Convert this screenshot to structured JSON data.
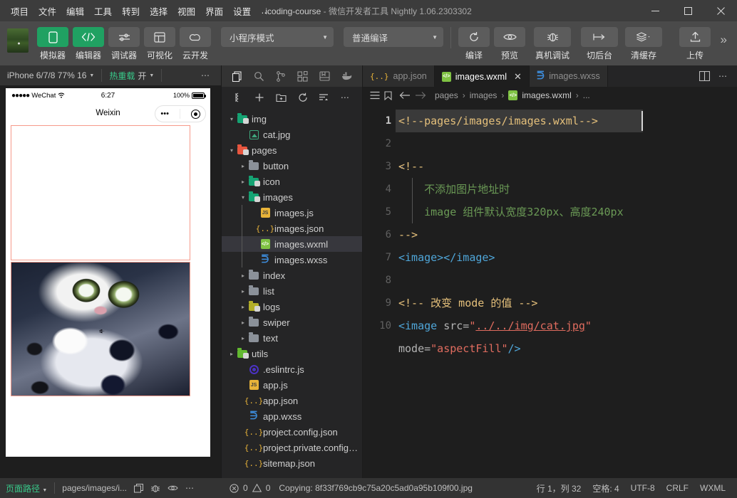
{
  "titlebar": {
    "menus": [
      "项目",
      "文件",
      "编辑",
      "工具",
      "转到",
      "选择",
      "视图",
      "界面",
      "设置",
      "…"
    ],
    "project_name": "icoding-course",
    "dash": "-",
    "app_name": "微信开发者工具 Nightly 1.06.2303302",
    "minimize": "—",
    "maximize": "□",
    "close": "✕"
  },
  "toolbar": {
    "buttons": [
      {
        "label": "模拟器",
        "icon": "phone-icon",
        "active": true
      },
      {
        "label": "编辑器",
        "icon": "code-icon",
        "active": true
      },
      {
        "label": "调试器",
        "icon": "sliders-icon",
        "active": false
      },
      {
        "label": "可视化",
        "icon": "layout-icon",
        "active": false
      },
      {
        "label": "云开发",
        "icon": "cloud-icon",
        "active": false
      }
    ],
    "mode_select": "小程序模式",
    "compile_select": "普通编译",
    "actions": [
      {
        "label": "编译",
        "icon": "refresh-icon"
      },
      {
        "label": "预览",
        "icon": "eye-icon"
      },
      {
        "label": "真机调试",
        "icon": "bug-icon"
      },
      {
        "label": "切后台",
        "icon": "background-icon"
      },
      {
        "label": "清缓存",
        "icon": "layers-icon"
      },
      {
        "label": "上传",
        "icon": "upload-icon"
      }
    ],
    "overflow": "»"
  },
  "simulator": {
    "device": "iPhone 6/7/8 77% 16",
    "hotreload_label": "热重载",
    "hotreload_value": "开",
    "more": "⋯",
    "phone": {
      "signal_dots": "●●●●●",
      "carrier": "WeChat",
      "wifi": "wifi-icon",
      "time": "6:27",
      "battery_pct": "100%",
      "nav_title": "Weixin",
      "capsule_menu": "•••",
      "capsule_target": "target-icon"
    }
  },
  "explorer": {
    "activity_icons": [
      "files-icon",
      "search-icon",
      "source-control-icon",
      "extensions-icon",
      "debug-icon",
      "docker-icon"
    ],
    "tool_icons": [
      "collapse-icon",
      "new-file-icon",
      "new-folder-icon",
      "refresh-icon",
      "sort-icon",
      "more-icon"
    ],
    "tree": [
      {
        "name": "img",
        "depth": 0,
        "type": "folder",
        "icon": "folder-teal",
        "arrow": "▾"
      },
      {
        "name": "cat.jpg",
        "depth": 1,
        "type": "image",
        "icon": "image-file",
        "arrow": ""
      },
      {
        "name": "pages",
        "depth": 0,
        "type": "folder",
        "icon": "folder-red",
        "arrow": "▾"
      },
      {
        "name": "button",
        "depth": 1,
        "type": "folder",
        "icon": "folder-gray",
        "arrow": "▸"
      },
      {
        "name": "icon",
        "depth": 1,
        "type": "folder",
        "icon": "folder-teal",
        "arrow": "▸"
      },
      {
        "name": "images",
        "depth": 1,
        "type": "folder",
        "icon": "folder-teal",
        "arrow": "▾"
      },
      {
        "name": "images.js",
        "depth": 2,
        "type": "js",
        "icon": "js-file",
        "arrow": ""
      },
      {
        "name": "images.json",
        "depth": 2,
        "type": "json",
        "icon": "json-file",
        "arrow": ""
      },
      {
        "name": "images.wxml",
        "depth": 2,
        "type": "wxml",
        "icon": "wxml-file",
        "arrow": "",
        "selected": true
      },
      {
        "name": "images.wxss",
        "depth": 2,
        "type": "wxss",
        "icon": "wxss-file",
        "arrow": ""
      },
      {
        "name": "index",
        "depth": 1,
        "type": "folder",
        "icon": "folder-gray",
        "arrow": "▸"
      },
      {
        "name": "list",
        "depth": 1,
        "type": "folder",
        "icon": "folder-gray",
        "arrow": "▸"
      },
      {
        "name": "logs",
        "depth": 1,
        "type": "folder",
        "icon": "folder-olive",
        "arrow": "▸"
      },
      {
        "name": "swiper",
        "depth": 1,
        "type": "folder",
        "icon": "folder-gray",
        "arrow": "▸"
      },
      {
        "name": "text",
        "depth": 1,
        "type": "folder",
        "icon": "folder-gray",
        "arrow": "▸"
      },
      {
        "name": "utils",
        "depth": 0,
        "type": "folder",
        "icon": "folder-green",
        "arrow": "▸"
      },
      {
        "name": ".eslintrc.js",
        "depth": 1,
        "type": "eslint",
        "icon": "eslint-file",
        "arrow": ""
      },
      {
        "name": "app.js",
        "depth": 1,
        "type": "js",
        "icon": "js-file",
        "arrow": ""
      },
      {
        "name": "app.json",
        "depth": 1,
        "type": "json",
        "icon": "json-file",
        "arrow": ""
      },
      {
        "name": "app.wxss",
        "depth": 1,
        "type": "wxss",
        "icon": "wxss-file",
        "arrow": ""
      },
      {
        "name": "project.config.json",
        "depth": 1,
        "type": "json",
        "icon": "json-file",
        "arrow": ""
      },
      {
        "name": "project.private.config.js...",
        "depth": 1,
        "type": "json",
        "icon": "json-file",
        "arrow": ""
      },
      {
        "name": "sitemap.json",
        "depth": 1,
        "type": "json",
        "icon": "json-file",
        "arrow": ""
      }
    ]
  },
  "editor": {
    "tabs": [
      {
        "label": "app.json",
        "icon": "json-file",
        "active": false,
        "closable": false
      },
      {
        "label": "images.wxml",
        "icon": "wxml-file",
        "active": true,
        "closable": true,
        "close": "✕"
      },
      {
        "label": "images.wxss",
        "icon": "wxss-file",
        "active": false,
        "closable": false
      }
    ],
    "tab_actions": [
      "split-editor-icon",
      "more-icon"
    ],
    "breadcrumb": {
      "icons": [
        "outline-icon",
        "bookmark-icon",
        "back-arrow-icon",
        "forward-arrow-icon"
      ],
      "parts": [
        "pages",
        "images",
        "images.wxml",
        "..."
      ],
      "separator": "›"
    },
    "lines": [
      {
        "no": "1",
        "current": true
      },
      {
        "no": "2",
        "current": false
      },
      {
        "no": "3",
        "current": false,
        "fold": "⌄"
      },
      {
        "no": "4",
        "current": false
      },
      {
        "no": "5",
        "current": false
      },
      {
        "no": "6",
        "current": false
      },
      {
        "no": "7",
        "current": false
      },
      {
        "no": "8",
        "current": false
      },
      {
        "no": "9",
        "current": false
      },
      {
        "no": "10",
        "current": false
      },
      {
        "no": "",
        "current": false
      }
    ],
    "code": {
      "l1": "<!--pages/images/images.wxml-->",
      "l3": "<!--",
      "l4": "不添加图片地址时",
      "l5": "image 组件默认宽度320px、高度240px",
      "l6": "-->",
      "l7_open": "<image>",
      "l7_close": "</image>",
      "l9": "<!-- 改变 mode 的值 -->",
      "l10_tag": "<image",
      "l10_attr": " src=",
      "l10_q": "\"",
      "l10_val": "../../img/cat.jpg",
      "l11_attr": "mode=",
      "l11_val": "\"aspectFill\"",
      "l11_end": "/>"
    }
  },
  "statusbar": {
    "page_path_label": "页面路径",
    "page_path_value": "pages/images/i...",
    "left_icons": [
      "copy-icon",
      "bug-icon",
      "eye-icon",
      "more-icon"
    ],
    "errors": "0",
    "warnings": "0",
    "message": "Copying: 8f33f769cb9c75a20c5ad0a95b109f00.jpg",
    "cursor": "行 1，列 32",
    "spaces": "空格: 4",
    "encoding": "UTF-8",
    "eol": "CRLF",
    "language": "WXML"
  },
  "colors": {
    "accent_green": "#20a162",
    "titlebar_bg": "#3c3c3c",
    "toolbar_bg": "#4a4a4a",
    "editor_bg": "#1e1e1e",
    "sidebar_bg": "#252526",
    "selection": "#37373d",
    "image_border": "#f79a8a"
  }
}
